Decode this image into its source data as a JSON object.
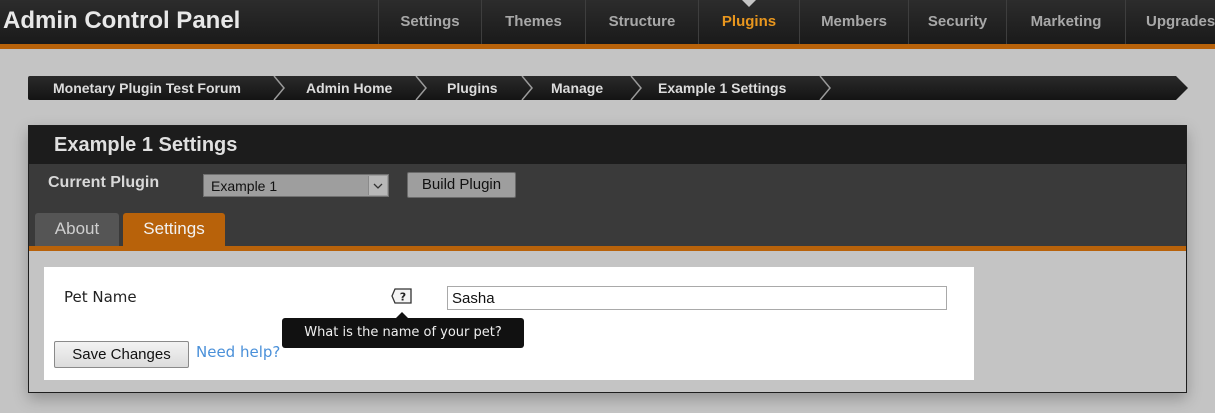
{
  "app": {
    "title": "Admin Control Panel",
    "accent_color": "#b8620a"
  },
  "nav": {
    "items": [
      {
        "label": "Settings",
        "active": false
      },
      {
        "label": "Themes",
        "active": false
      },
      {
        "label": "Structure",
        "active": false
      },
      {
        "label": "Plugins",
        "active": true
      },
      {
        "label": "Members",
        "active": false
      },
      {
        "label": "Security",
        "active": false
      },
      {
        "label": "Marketing",
        "active": false
      },
      {
        "label": "Upgrades",
        "active": false
      }
    ]
  },
  "breadcrumb": {
    "items": [
      "Monetary Plugin Test Forum",
      "Admin Home",
      "Plugins",
      "Manage",
      "Example 1 Settings"
    ]
  },
  "panel": {
    "title": "Example 1 Settings",
    "current_plugin_label": "Current Plugin",
    "current_plugin_value": "Example 1",
    "build_button_label": "Build Plugin",
    "tabs": [
      {
        "label": "About",
        "active": false
      },
      {
        "label": "Settings",
        "active": true
      }
    ]
  },
  "form": {
    "field_label": "Pet Name",
    "field_value": "Sasha",
    "help_icon": "help-question-icon",
    "tooltip_text": "What is the name of your pet?",
    "save_button_label": "Save Changes",
    "help_link_text": "Need help?"
  }
}
